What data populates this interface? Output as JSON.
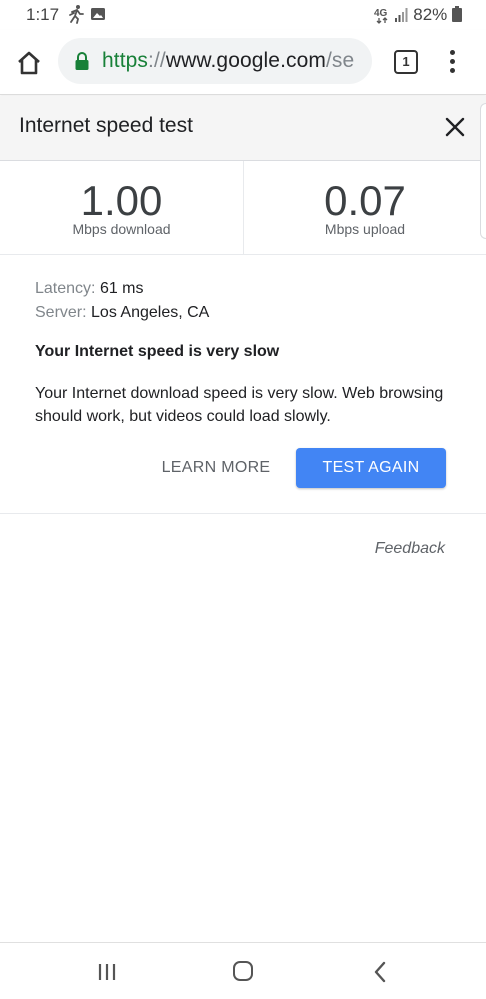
{
  "status_bar": {
    "time": "1:17",
    "network": "4G",
    "battery": "82%",
    "icons": [
      "activity-icon",
      "image-icon",
      "signal-icon",
      "battery-icon"
    ]
  },
  "browser": {
    "url_scheme": "https",
    "url_separator": "://",
    "url_host": "www.google.com",
    "url_path": "/se",
    "tab_count": "1"
  },
  "card": {
    "title": "Internet speed test",
    "download": {
      "value": "1.00",
      "label": "Mbps download"
    },
    "upload": {
      "value": "0.07",
      "label": "Mbps upload"
    },
    "latency": {
      "key": "Latency:",
      "value": "61 ms"
    },
    "server": {
      "key": "Server:",
      "value": "Los Angeles, CA"
    },
    "verdict": "Your Internet speed is very slow",
    "description": "Your Internet download speed is very slow. Web browsing should work, but videos could load slowly.",
    "learn_more": "LEARN MORE",
    "test_again": "TEST AGAIN",
    "feedback": "Feedback"
  },
  "colors": {
    "accent": "#4285f4",
    "secure_green": "#188038"
  }
}
